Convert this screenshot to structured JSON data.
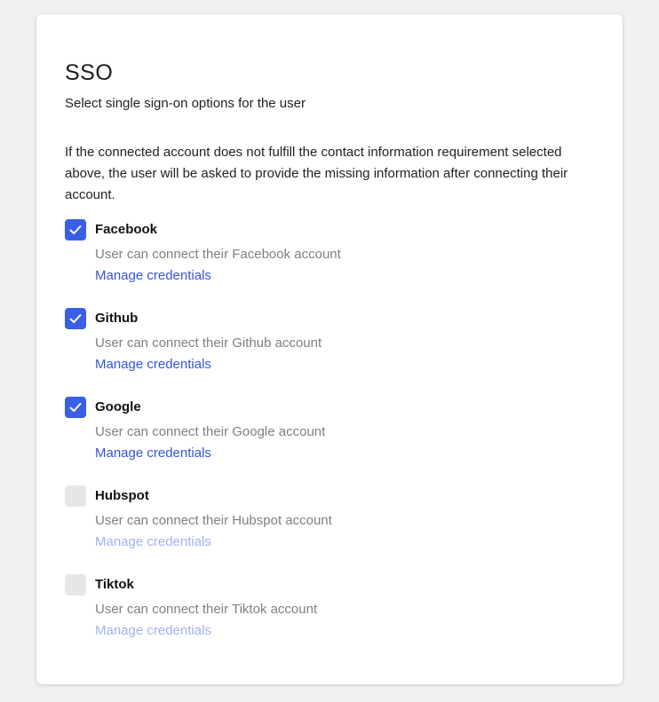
{
  "title": "SSO",
  "subtitle": "Select single sign-on options for the user",
  "description": "If the connected account does not fulfill the contact information requirement selected above, the user will be asked to provide the missing information after connecting their account.",
  "colors": {
    "accent": "#3b5ee8",
    "link": "#3555d6",
    "link_disabled": "#a3b1ec",
    "unchecked": "#e6e6e6"
  },
  "providers": [
    {
      "name": "Facebook",
      "checked": true,
      "description": "User can connect their Facebook account",
      "link": "Manage credentials"
    },
    {
      "name": "Github",
      "checked": true,
      "description": "User can connect their Github account",
      "link": "Manage credentials"
    },
    {
      "name": "Google",
      "checked": true,
      "description": "User can connect their Google account",
      "link": "Manage credentials"
    },
    {
      "name": "Hubspot",
      "checked": false,
      "description": "User can connect their Hubspot account",
      "link": "Manage credentials"
    },
    {
      "name": "Tiktok",
      "checked": false,
      "description": "User can connect their Tiktok account",
      "link": "Manage credentials"
    }
  ]
}
